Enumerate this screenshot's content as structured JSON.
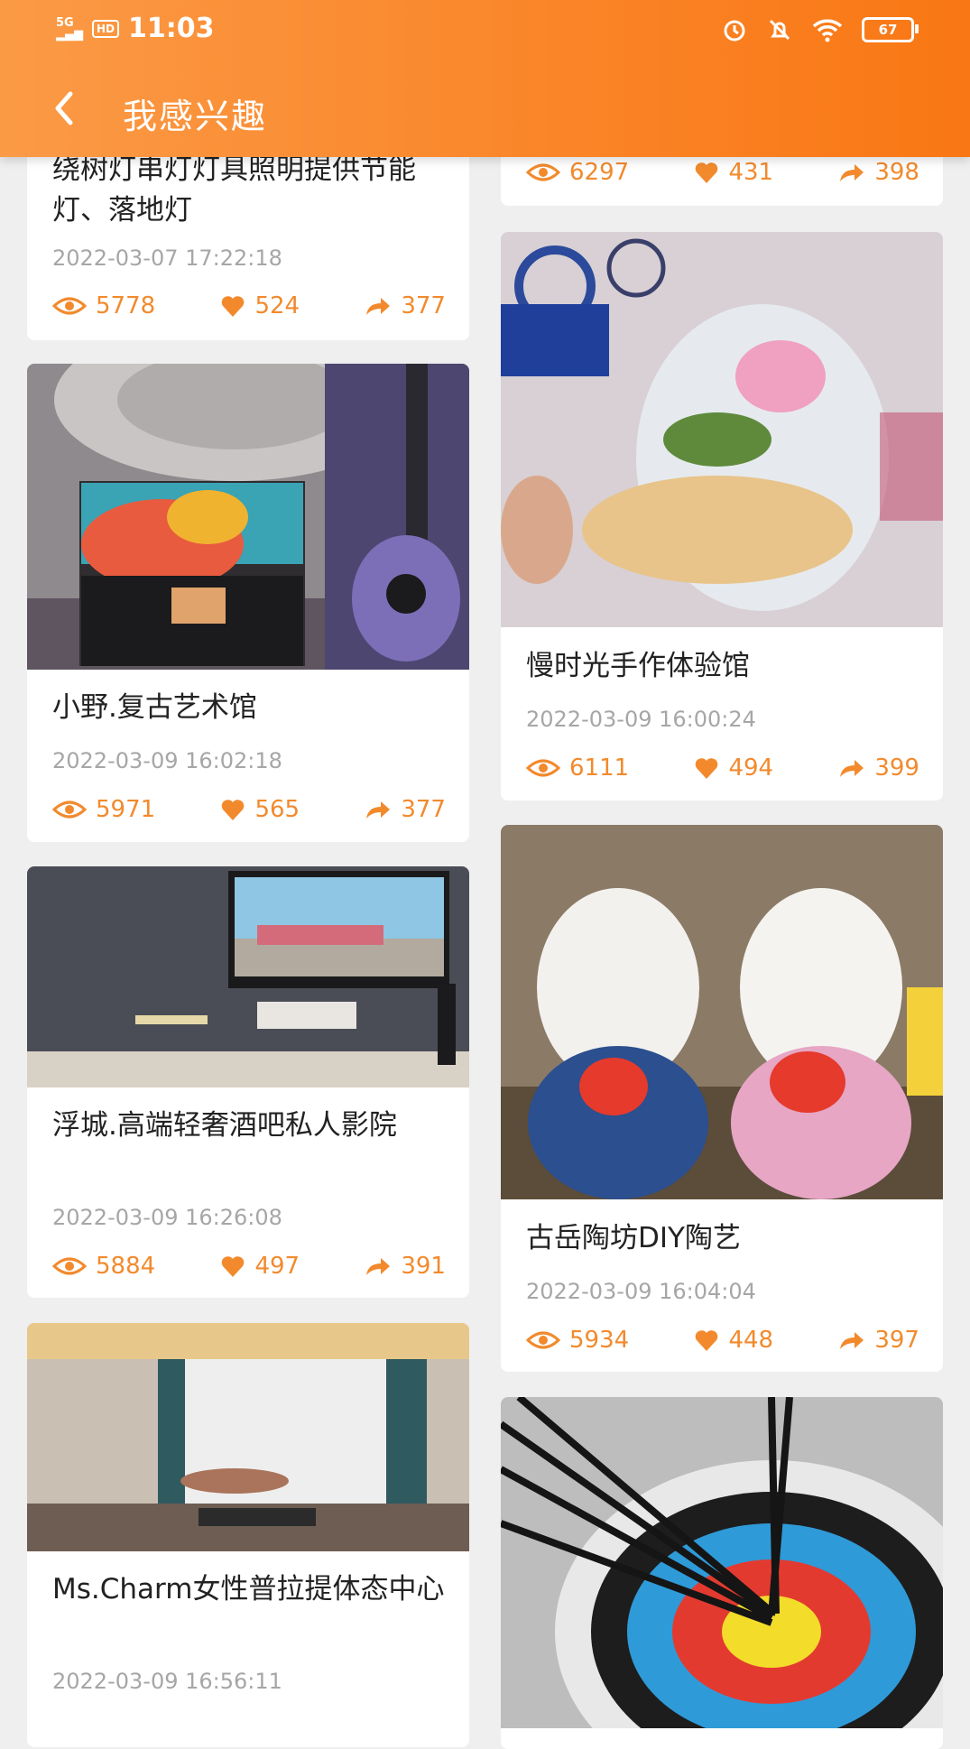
{
  "status_bar": {
    "network": "5G",
    "hd": "HD",
    "time": "11:03",
    "battery": "67"
  },
  "nav": {
    "title": "我感兴趣"
  },
  "colors": {
    "accent": "#f28a2d",
    "header_start": "#fb9a46",
    "header_end": "#f97714"
  },
  "left_column": [
    {
      "title": "绕树灯串灯灯具照明提供节能灯、落地灯",
      "date": "2022-03-07 17:22:18",
      "views": "5778",
      "likes": "524",
      "shares": "377"
    },
    {
      "title": "小野.复古艺术馆",
      "date": "2022-03-09 16:02:18",
      "views": "5971",
      "likes": "565",
      "shares": "377",
      "image": "painting-guitar-art-photo"
    },
    {
      "title": "浮城.高端轻奢酒吧私人影院",
      "date": "2022-03-09 16:26:08",
      "views": "5884",
      "likes": "497",
      "shares": "391",
      "image": "home-theater-photo"
    },
    {
      "title": "Ms.Charm女性普拉提体态中心",
      "date": "2022-03-09 16:56:11",
      "image": "pilates-studio-photo"
    }
  ],
  "right_column": [
    {
      "views": "6297",
      "likes": "431",
      "shares": "398"
    },
    {
      "title": "慢时光手作体验馆",
      "date": "2022-03-09 16:00:24",
      "views": "6111",
      "likes": "494",
      "shares": "399",
      "image": "glass-dome-flower-photo"
    },
    {
      "title": "古岳陶坊DIY陶艺",
      "date": "2022-03-09 16:04:04",
      "views": "5934",
      "likes": "448",
      "shares": "397",
      "image": "ceramic-cats-photo"
    },
    {
      "image": "archery-target-photo"
    }
  ]
}
